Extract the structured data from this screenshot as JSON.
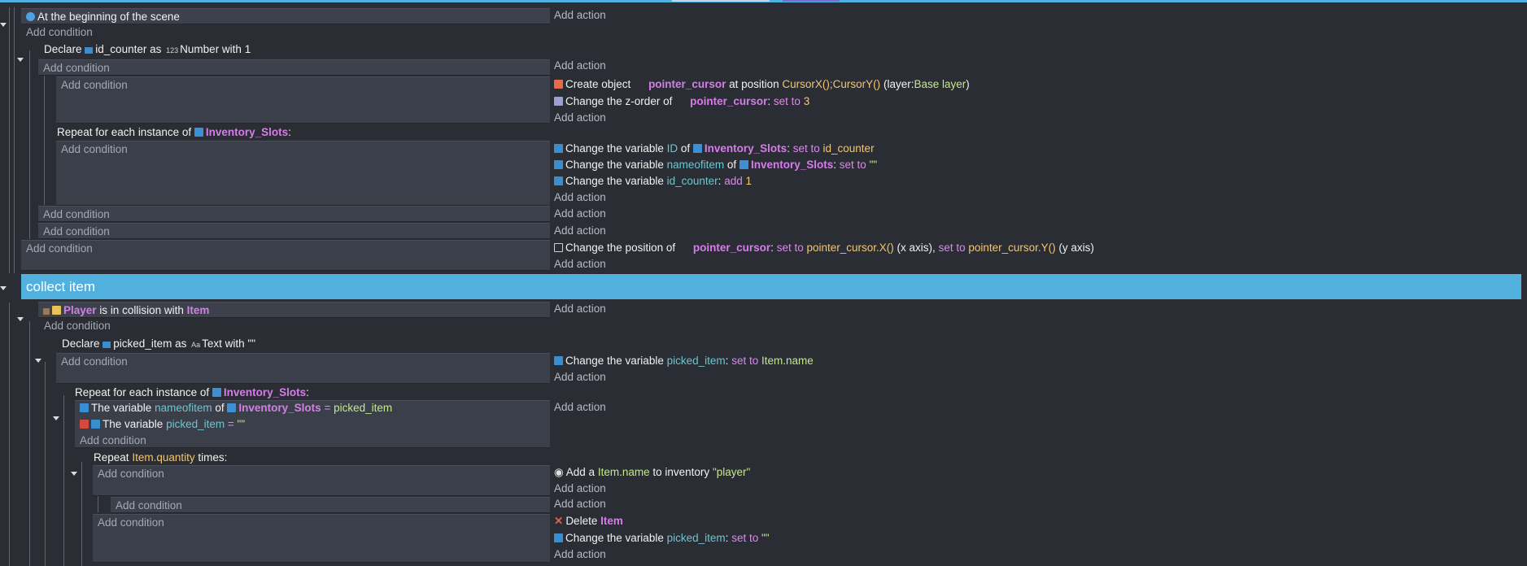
{
  "events": {
    "e1": {
      "condition": "At the beginning of the scene",
      "add_condition": "Add condition",
      "add_action": "Add action"
    },
    "e2": {
      "declare": "Declare",
      "var": "id_counter",
      "as": "as",
      "type_icon": "123",
      "type": "Number with 1"
    },
    "e3": {
      "add_condition": "Add condition",
      "add_action": "Add action"
    },
    "e4": {
      "add_condition": "Add condition",
      "a1": {
        "pre": "Create object",
        "obj": "pointer_cursor",
        "mid": "at position",
        "expr": "CursorX();CursorY()",
        "layer_pre": "(layer:",
        "layer": "Base layer",
        "layer_post": ")"
      },
      "a2": {
        "pre": "Change the z-order of",
        "obj": "pointer_cursor",
        "sep": ":",
        "op": "set to",
        "val": "3"
      },
      "add_action": "Add action"
    },
    "e5": {
      "repeat_pre": "Repeat for each instance of",
      "repeat_obj": "Inventory_Slots",
      "repeat_post": ":",
      "add_condition": "Add condition",
      "a1": {
        "pre": "Change the variable",
        "var": "ID",
        "of": "of",
        "obj": "Inventory_Slots",
        "sep": ":",
        "op": "set to",
        "val": "id_counter"
      },
      "a2": {
        "pre": "Change the variable",
        "var": "nameofitem",
        "of": "of",
        "obj": "Inventory_Slots",
        "sep": ":",
        "op": "set to",
        "val": "\"\""
      },
      "a3": {
        "pre": "Change the variable",
        "var": "id_counter",
        "sep": ":",
        "op": "add",
        "val": "1"
      },
      "add_action": "Add action"
    },
    "e6": {
      "add_condition": "Add condition",
      "add_action": "Add action"
    },
    "e7": {
      "add_condition": "Add condition",
      "add_action": "Add action"
    },
    "e8": {
      "add_condition": "Add condition",
      "a1": {
        "pre": "Change the position of",
        "obj": "pointer_cursor",
        "sep": ":",
        "op1": "set to",
        "expr1": "pointer_cursor.X()",
        "axis1": "(x axis),",
        "op2": "set to",
        "expr2": "pointer_cursor.Y()",
        "axis2": "(y axis)"
      },
      "add_action": "Add action"
    },
    "group": {
      "title": "collect item"
    },
    "e9": {
      "obj": "Player",
      "mid": "is in collision with",
      "obj2": "Item",
      "add_condition": "Add condition",
      "add_action": "Add action"
    },
    "e10": {
      "declare": "Declare",
      "var": "picked_item",
      "as": "as",
      "type_icon": "Aa",
      "type": "Text with \"\""
    },
    "e11": {
      "add_condition": "Add condition",
      "a1": {
        "pre": "Change the variable",
        "var": "picked_item",
        "sep": ":",
        "op": "set to",
        "val": "Item.name"
      },
      "add_action": "Add action"
    },
    "e12": {
      "repeat_pre": "Repeat for each instance of",
      "repeat_obj": "Inventory_Slots",
      "repeat_post": ":",
      "c1": {
        "pre": "The variable",
        "var": "nameofitem",
        "of": "of",
        "obj": "Inventory_Slots",
        "op": "=",
        "val": "picked_item"
      },
      "c2": {
        "pre": "The variable",
        "var": "picked_item",
        "op": "=",
        "val": "\"\""
      },
      "add_condition": "Add condition",
      "add_action": "Add action"
    },
    "e13": {
      "repeat_pre": "Repeat",
      "expr": "Item.quantity",
      "repeat_post": "times:",
      "add_condition": "Add condition",
      "a1": {
        "pre": "Add a",
        "val": "Item.name",
        "mid": "to inventory",
        "str": "\"player\""
      },
      "add_action": "Add action"
    },
    "e14": {
      "add_condition": "Add condition",
      "add_action": "Add action"
    },
    "e15": {
      "add_condition": "Add condition",
      "a1": {
        "pre": "Delete",
        "obj": "Item"
      },
      "a2": {
        "pre": "Change the variable",
        "var": "picked_item",
        "sep": ":",
        "op": "set to",
        "val": "\"\""
      },
      "add_action": "Add action"
    }
  },
  "icons": {
    "scene_start": "eye-icon",
    "variable": "variable-icon",
    "object": "object-icon",
    "create": "create-object-icon",
    "zorder": "z-order-icon",
    "position": "position-icon",
    "collision": "collision-icon",
    "inverted": "inverted-condition-icon",
    "inventory": "inventory-icon",
    "delete": "delete-icon"
  },
  "colors": {
    "group_header": "#52b0df",
    "object_name": "#d47ee8",
    "variable_name": "#6ec5cf",
    "expression": "#f0c674",
    "string": "#c3e88d"
  }
}
